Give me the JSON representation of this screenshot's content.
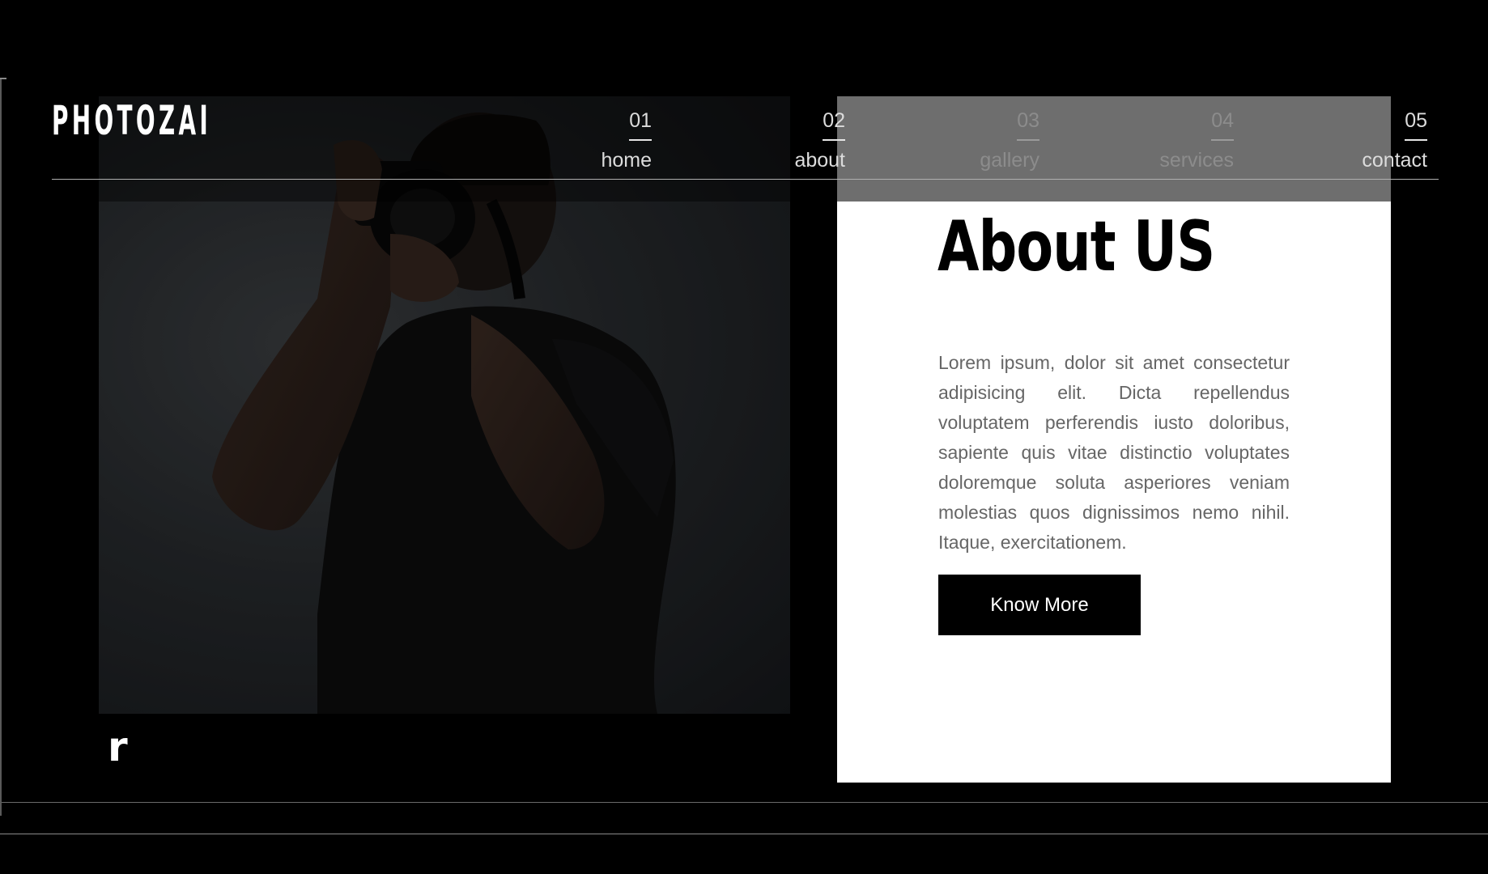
{
  "brand": {
    "logo_text": "PHOTOZAI"
  },
  "nav": {
    "items": [
      {
        "number": "01",
        "label": "home"
      },
      {
        "number": "02",
        "label": "about"
      },
      {
        "number": "03",
        "label": "gallery"
      },
      {
        "number": "04",
        "label": "services"
      },
      {
        "number": "05",
        "label": "contact"
      }
    ]
  },
  "hero": {
    "image_icon": "photographer-with-camera-photo",
    "stray_text": "r"
  },
  "about": {
    "title": "About US",
    "body": "Lorem ipsum, dolor sit amet consectetur adipisicing elit. Dicta repellendus voluptatem perferendis iusto doloribus, sapiente quis vitae distinctio voluptates doloremque soluta asperiores veniam molestias quos dignissimos nemo nihil. Itaque, exercitationem.",
    "button_label": "Know More"
  },
  "colors": {
    "background": "#000000",
    "card": "#ffffff",
    "header_overlay": "#6e6e6e",
    "body_text": "#666666",
    "button_bg": "#000000"
  }
}
